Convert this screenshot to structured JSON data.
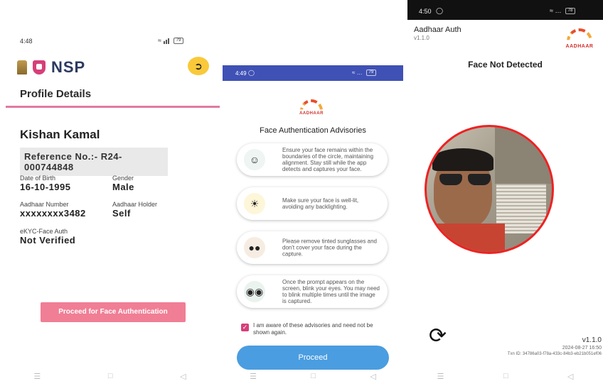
{
  "screen1": {
    "status_time": "4:48",
    "status_battery": "79",
    "app_name": "NSP",
    "section_title": "Profile Details",
    "name": "Kishan Kamal",
    "reference": "Reference No.:- R24-000744848",
    "fields": [
      {
        "label": "Date of Birth",
        "value": "16-10-1995"
      },
      {
        "label": "Gender",
        "value": "Male"
      },
      {
        "label": "Aadhaar Number",
        "value": "xxxxxxxx3482"
      },
      {
        "label": "Aadhaar Holder",
        "value": "Self"
      },
      {
        "label": "eKYC-Face Auth",
        "value": "Not Verified"
      }
    ],
    "proceed_face_label": "Proceed for Face Authentication",
    "logout_icon": "logout-icon"
  },
  "screen2": {
    "status_time": "4:49",
    "status_battery": "79",
    "logo_text": "AADHAAR",
    "title": "Face Authentication Advisories",
    "advisories": [
      {
        "icon": "face-circle-icon",
        "text": "Ensure your face remains within the boundaries of the circle, maintaining alignment. Stay still while the app detects and captures your face."
      },
      {
        "icon": "light-bulb-icon",
        "text": "Make sure your face is well-lit, avoiding any backlighting."
      },
      {
        "icon": "sunglasses-icon",
        "text": "Please remove tinted sunglasses and don't cover your face during the capture."
      },
      {
        "icon": "eyes-blink-icon",
        "text": "Once the prompt appears on the screen, blink your eyes. You may need to blink multiple times until the image is captured."
      }
    ],
    "checkbox_label": "I am aware of these advisories and need not be shown again.",
    "checkbox_checked": true,
    "proceed_label": "Proceed"
  },
  "screen3": {
    "status_time": "4:50",
    "status_battery": "78",
    "app_title": "Aadhaar Auth",
    "app_version_top": "v1.1.0",
    "logo_text": "AADHAAR",
    "message": "Face Not Detected",
    "version_bottom": "v1.1.0",
    "timestamp": "2024-08-27 16:50",
    "txn": "Txn ID: 34786a03-f78a-433c-84b3-eb21b051ef06"
  },
  "colors": {
    "nsp_pink": "#d63f79",
    "logout_yellow": "#f9c93a",
    "face_button": "#f07e95",
    "status_blue": "#3f51b5",
    "proceed_blue": "#4a9de0",
    "detect_ring": "#e22222"
  }
}
